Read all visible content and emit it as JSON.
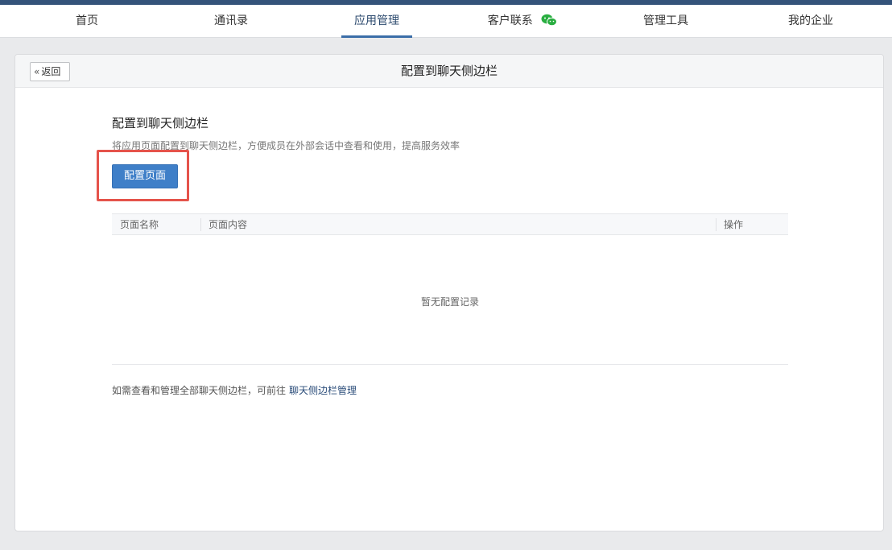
{
  "nav": {
    "items": [
      {
        "label": "首页"
      },
      {
        "label": "通讯录"
      },
      {
        "label": "应用管理",
        "active": true
      },
      {
        "label": "客户联系",
        "icon": "wechat-icon"
      },
      {
        "label": "管理工具"
      },
      {
        "label": "我的企业"
      }
    ],
    "accent_color": "#3b6ea8",
    "wechat_icon_color": "#2aae41"
  },
  "header": {
    "back_label": "返回",
    "back_icon": "double-chevron-left-icon",
    "title": "配置到聊天侧边栏"
  },
  "section": {
    "title": "配置到聊天侧边栏",
    "description": "将应用页面配置到聊天侧边栏，方便成员在外部会话中查看和使用，提高服务效率",
    "button_label": "配置页面",
    "button_color": "#3f7fc8",
    "highlight_color": "#e5534b"
  },
  "table": {
    "columns": [
      "页面名称",
      "页面内容",
      "操作"
    ],
    "rows": [],
    "empty_text": "暂无配置记录"
  },
  "footnote": {
    "text": "如需查看和管理全部聊天侧边栏，可前往",
    "link_label": "聊天侧边栏管理"
  }
}
